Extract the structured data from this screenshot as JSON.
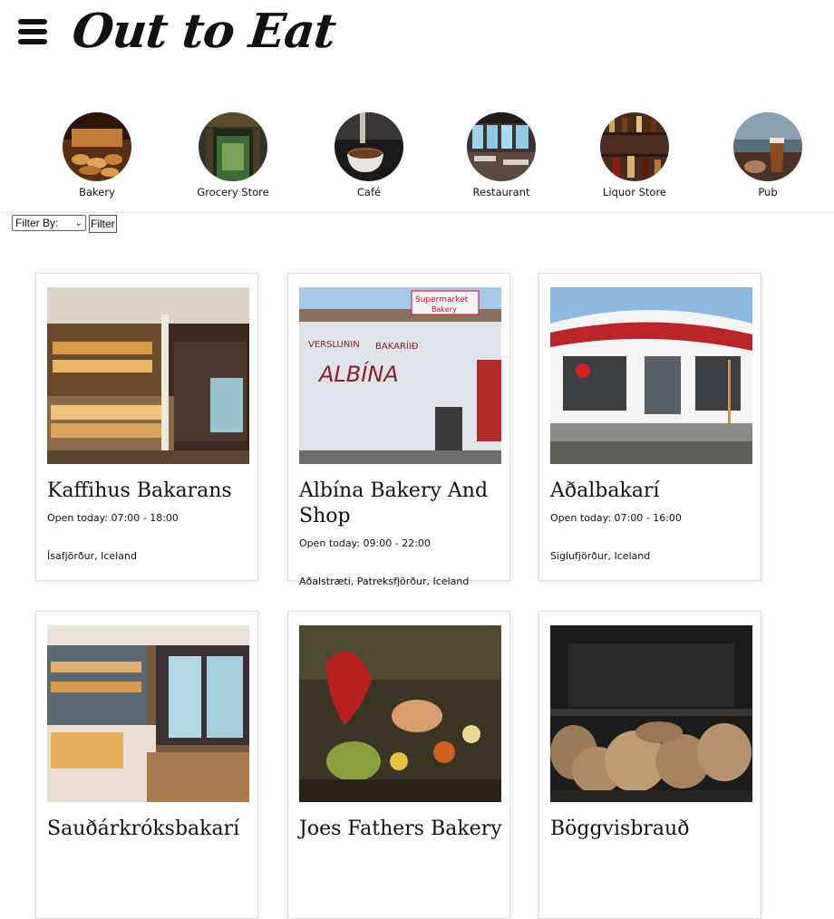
{
  "header": {
    "logo_text": "Out to Eat"
  },
  "categories": [
    {
      "label": "Bakery"
    },
    {
      "label": "Grocery Store"
    },
    {
      "label": "Café"
    },
    {
      "label": "Restaurant"
    },
    {
      "label": "Liquor Store"
    },
    {
      "label": "Pub"
    }
  ],
  "filter": {
    "select_value": "Filter By:",
    "button_label": "Filter"
  },
  "cards": [
    {
      "name": "Kaffihus Bakarans",
      "hours": "Open today: 07:00 - 18:00",
      "location": "Ísafjörður, Iceland"
    },
    {
      "name": "Albína Bakery And Shop",
      "hours": "Open today: 09:00 - 22:00",
      "location": "Aðalstræti, Patreksfjörður, Iceland"
    },
    {
      "name": "Aðalbakarí",
      "hours": "Open today: 07:00 - 16:00",
      "location": "Siglufjörður, Iceland"
    },
    {
      "name": "Sauðárkróksbakarí",
      "hours": "",
      "location": ""
    },
    {
      "name": "Joes Fathers Bakery",
      "hours": "",
      "location": ""
    },
    {
      "name": "Böggvisbrauð",
      "hours": "",
      "location": ""
    }
  ]
}
